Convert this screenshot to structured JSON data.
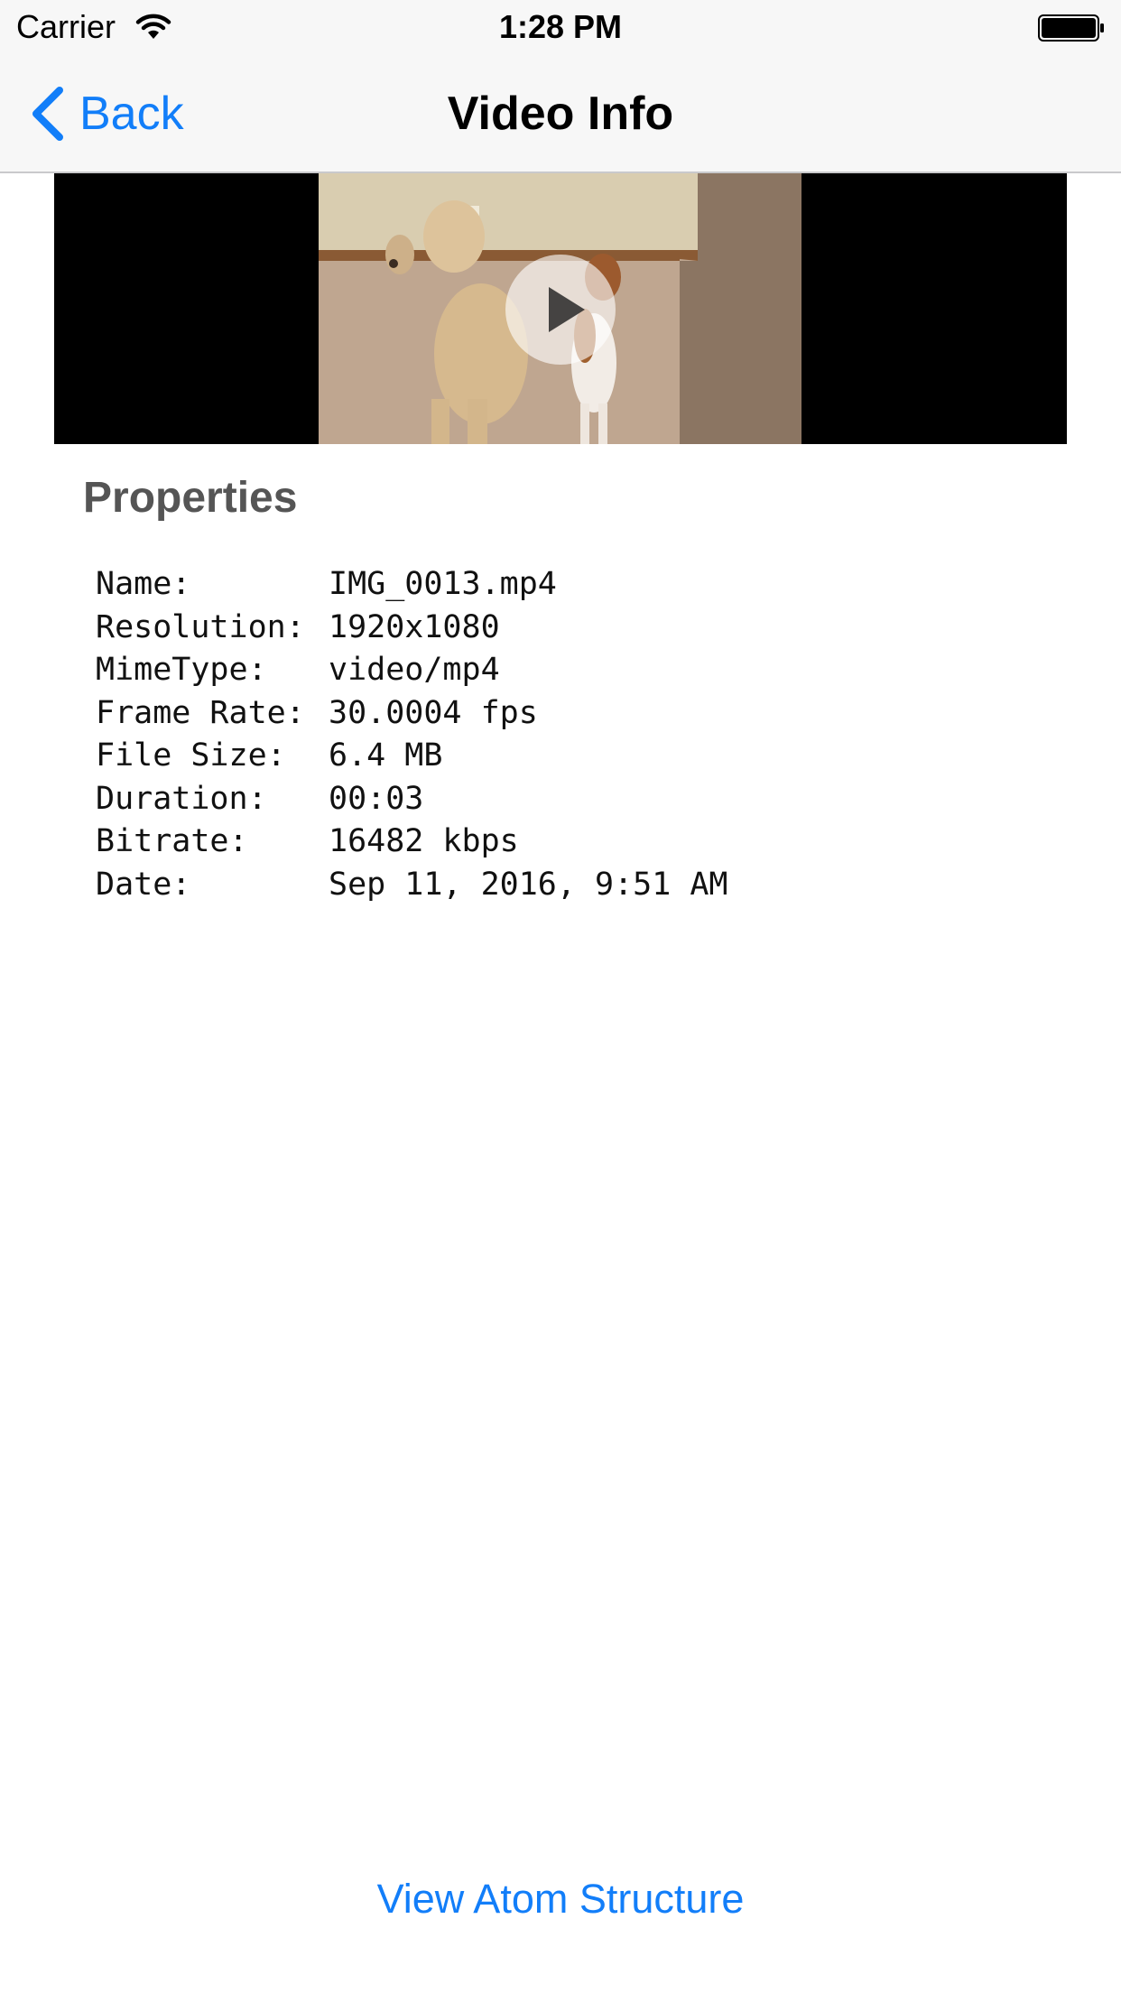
{
  "status_bar": {
    "carrier": "Carrier",
    "time": "1:28 PM"
  },
  "nav": {
    "back_label": "Back",
    "title": "Video Info"
  },
  "properties": {
    "title": "Properties",
    "rows": [
      {
        "label": "Name:",
        "value": "IMG_0013.mp4"
      },
      {
        "label": "Resolution:",
        "value": "1920x1080"
      },
      {
        "label": "MimeType:",
        "value": "video/mp4"
      },
      {
        "label": "Frame Rate:",
        "value": "30.0004 fps"
      },
      {
        "label": "File Size:",
        "value": "6.4 MB"
      },
      {
        "label": "Duration:",
        "value": "00:03"
      },
      {
        "label": "Bitrate:",
        "value": "16482 kbps"
      },
      {
        "label": "Date:",
        "value": "Sep 11, 2016, 9:51 AM"
      }
    ]
  },
  "footer": {
    "atom_button_label": "View Atom Structure"
  },
  "icons": {
    "wifi": "wifi-icon",
    "battery": "battery-icon",
    "back": "chevron-left-icon",
    "play": "play-icon"
  },
  "colors": {
    "accent": "#127ef9",
    "bar_background": "#f7f7f7",
    "section_title": "#555555"
  }
}
